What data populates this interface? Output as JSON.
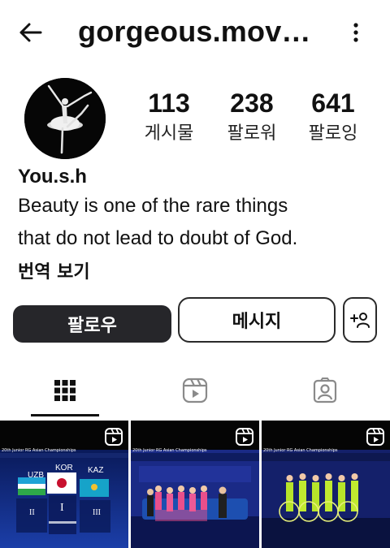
{
  "header": {
    "username": "gorgeous.mov…",
    "back_icon": "arrow-left-icon",
    "more_icon": "more-vertical-icon"
  },
  "profile": {
    "avatar_icon": "ballerina-avatar",
    "stats": [
      {
        "count": "113",
        "label": "게시물"
      },
      {
        "count": "238",
        "label": "팔로워"
      },
      {
        "count": "641",
        "label": "팔로잉"
      }
    ],
    "display_name": "You.s.h",
    "bio_lines": [
      "Beauty is one of the rare things",
      "that do not lead to doubt of God."
    ],
    "translate_label": "번역 보기"
  },
  "actions": {
    "follow_label": "팔로우",
    "message_label": "메시지",
    "add_person_icon": "add-person-icon"
  },
  "tabs": [
    {
      "icon": "grid-icon",
      "active": true
    },
    {
      "icon": "reels-icon",
      "active": false
    },
    {
      "icon": "tagged-icon",
      "active": false
    }
  ],
  "posts": [
    {
      "type": "reel",
      "caption": "20th Junior RG Asian Championships",
      "podium": [
        "UZB",
        "KOR",
        "KAZ"
      ],
      "places": [
        "II",
        "I",
        "III"
      ]
    },
    {
      "type": "reel",
      "caption": "20th Junior RG Asian Championships"
    },
    {
      "type": "reel",
      "caption": "20th Junior RG Asian Championships"
    }
  ],
  "colors": {
    "primary_button": "#26262a",
    "text": "#111111",
    "background": "#ffffff",
    "tile_background": "#0b1640"
  }
}
